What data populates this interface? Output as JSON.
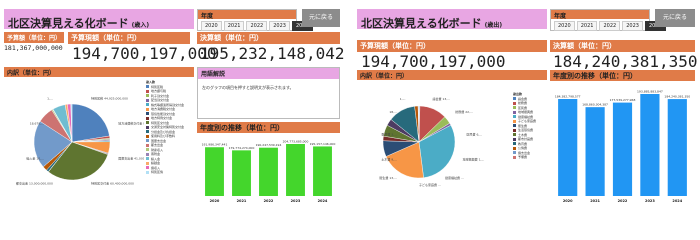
{
  "left": {
    "title": "北区決算見える化ボード",
    "title_sub": "(歳入)",
    "year_label": "年度",
    "years": [
      "2020",
      "2021",
      "2022",
      "2023",
      "2024"
    ],
    "selected_year": "2024",
    "back_label": "元に戻る",
    "yosan_label": "予算額（単位：円）",
    "yosan_value": "181,367,000,000",
    "yosan_genkei_label": "予算現額（単位：円）",
    "yosan_genkei_value": "194,700,197,000",
    "kessan_label": "決算額（単位：円）",
    "kessan_value": "195,232,148,042",
    "breakdown_label": "内訳（単位：円）",
    "legend_title": "歳入款",
    "legend": [
      {
        "name": "特別区税",
        "color": "#4f81bd"
      },
      {
        "name": "地方譲与税",
        "color": "#c0504d"
      },
      {
        "name": "利子割交付金",
        "color": "#9bbb59"
      },
      {
        "name": "配当割交付金",
        "color": "#8064a2"
      },
      {
        "name": "株式等譲渡所得割交付金",
        "color": "#4bacc6"
      },
      {
        "name": "地方消費税交付金",
        "color": "#f79646"
      },
      {
        "name": "環境性能割交付金",
        "color": "#2c4d75"
      },
      {
        "name": "地方特例交付金",
        "color": "#772c2a"
      },
      {
        "name": "特別区交付金",
        "color": "#5f7530"
      },
      {
        "name": "交通安全対策特別交付金",
        "color": "#4d3b62"
      },
      {
        "name": "分担金及び負担金",
        "color": "#276a7c"
      },
      {
        "name": "使用料及び手数料",
        "color": "#b65708"
      },
      {
        "name": "国庫支出金",
        "color": "#729aca"
      },
      {
        "name": "都支出金",
        "color": "#cd7371"
      },
      {
        "name": "財産収入",
        "color": "#afc97a"
      },
      {
        "name": "寄附金",
        "color": "#9983b5"
      },
      {
        "name": "繰入金",
        "color": "#6fbdd1"
      },
      {
        "name": "繰越金",
        "color": "#f9ab6b"
      },
      {
        "name": "諸収入",
        "color": "#e86ab8"
      },
      {
        "name": "特別区債",
        "color": "#b2e0f5"
      }
    ],
    "pie_labels": [
      "特別区税 44,925,000,000",
      "地方消費税交付金 9,...",
      "国庫支出金 41,000,000,000",
      "特別区交付金 60,400,000,000",
      "都支出金 13,000,000,000",
      "繰入金 10,...",
      "18,679,...",
      "1,..."
    ],
    "glossary_title": "用語解説",
    "glossary_text": "左のグラフの項目を押すと説明文が表示されます。",
    "trend_label": "年度別の推移（単位：円）",
    "trend_color": "#44d62c",
    "chart_data": {
      "type": "bar",
      "categories": [
        "2020",
        "2021",
        "2022",
        "2023",
        "2024"
      ],
      "values": [
        191986347441,
        179774274000,
        190247539194,
        204773685000,
        195157146000
      ],
      "value_labels": [
        "191,986,347,441",
        "179,774,274,000",
        "190,247,539,194",
        "204,773,685,000",
        "195,157,146,000"
      ],
      "title": "",
      "xlabel": "",
      "ylabel": ""
    }
  },
  "right": {
    "title": "北区決算見える化ボード",
    "title_sub": "(歳出)",
    "year_label": "年度",
    "years": [
      "2020",
      "2021",
      "2022",
      "2023",
      "2024"
    ],
    "selected_year": "2024",
    "back_label": "元に戻る",
    "yosan_genkei_label": "予算現額（単位：円）",
    "yosan_genkei_value": "194,700,197,000",
    "kessan_label": "決算額（単位：円）",
    "kessan_value": "184,240,381,350",
    "breakdown_label": "内訳（単位：円）",
    "legend_title": "歳出款",
    "legend": [
      {
        "name": "議会費",
        "color": "#4f81bd"
      },
      {
        "name": "総務費",
        "color": "#c0504d"
      },
      {
        "name": "区民費",
        "color": "#9bbb59"
      },
      {
        "name": "地域振興費",
        "color": "#8064a2"
      },
      {
        "name": "健康福祉費",
        "color": "#4bacc6"
      },
      {
        "name": "子ども家庭費",
        "color": "#f79646"
      },
      {
        "name": "衛生費",
        "color": "#2c4d75"
      },
      {
        "name": "生活環境費",
        "color": "#772c2a"
      },
      {
        "name": "土木費",
        "color": "#5f7530"
      },
      {
        "name": "都市計画費",
        "color": "#4d3b62"
      },
      {
        "name": "教育費",
        "color": "#276a7c"
      },
      {
        "name": "公債費",
        "color": "#b65708"
      },
      {
        "name": "諸支出金",
        "color": "#729aca"
      },
      {
        "name": "予備費",
        "color": "#cd7371"
      }
    ],
    "pie_labels": [
      "議会費 13,...",
      "総務費 22,...",
      "区民費 6,...",
      "地域振興費 1,...",
      "健康福祉費 ...",
      "子ども家庭費 ...",
      "衛生費 13,...",
      "土木費 9,...",
      "教育費 3,...",
      "18,...",
      "1,..."
    ],
    "trend_label": "年度別の推移（単位：円）",
    "trend_color": "#2196f3",
    "chart_data": {
      "type": "bar",
      "categories": [
        "2020",
        "2021",
        "2022",
        "2023",
        "2024"
      ],
      "values": [
        184382798577,
        168860304387,
        177539277968,
        193885883847,
        184240381350
      ],
      "value_labels": [
        "184,382,798,577",
        "168,860,304,387",
        "177,539,277,968",
        "193,885,883,847",
        "184,240,381,350"
      ],
      "title": "",
      "xlabel": "",
      "ylabel": ""
    }
  }
}
